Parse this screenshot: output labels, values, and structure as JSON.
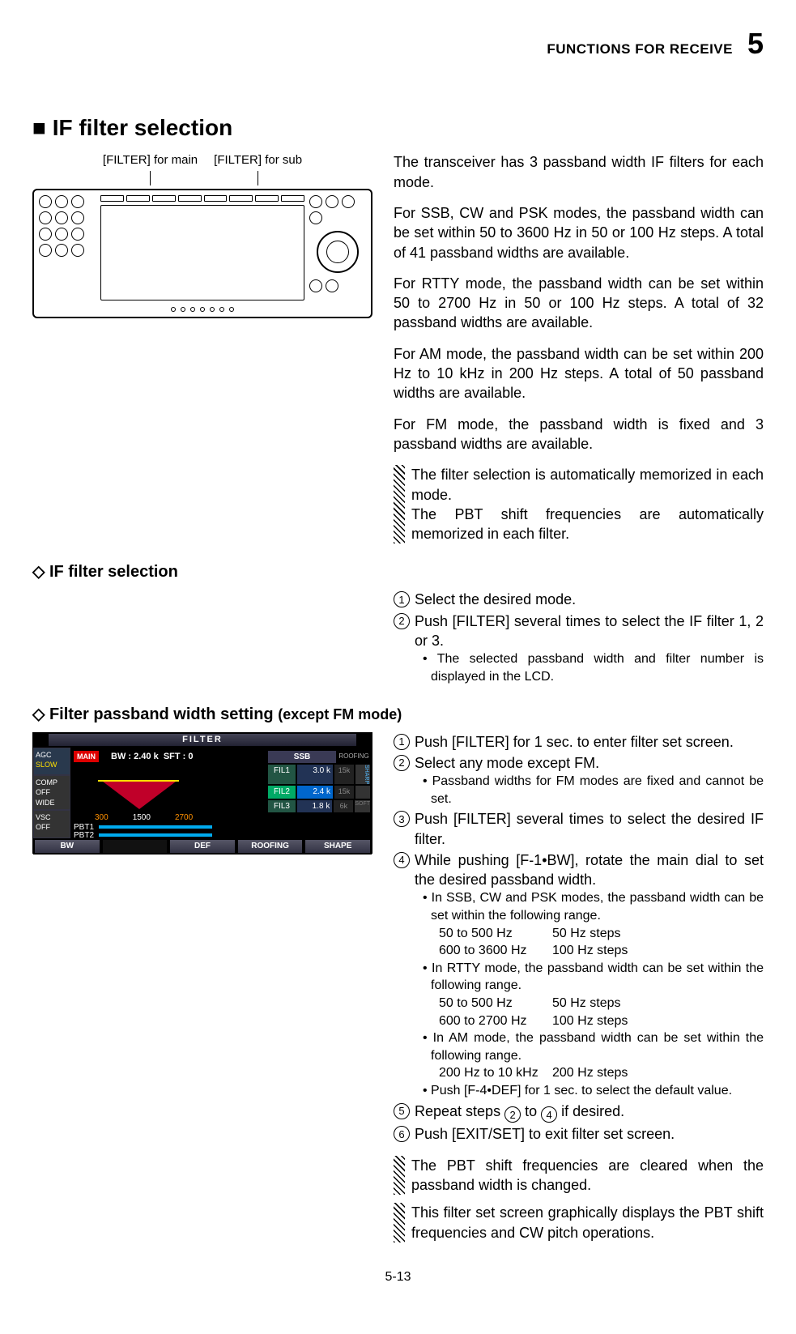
{
  "header": {
    "section": "FUNCTIONS FOR RECEIVE",
    "chapter": "5"
  },
  "h1": "■ IF filter selection",
  "callouts": {
    "main": "[FILTER] for main",
    "sub": "[FILTER] for sub"
  },
  "intro": {
    "p1": "The transceiver has 3 passband width IF filters for each mode.",
    "p2": "For SSB, CW and PSK modes, the passband width can be set within 50 to 3600 Hz in 50 or 100 Hz steps. A total of 41 passband widths are available.",
    "p3": "For RTTY mode, the passband width can be set within 50 to 2700 Hz in 50 or 100 Hz steps. A total of 32 passband widths are available.",
    "p4": "For AM mode, the passband width can be set within 200 Hz to 10 kHz in 200 Hz steps. A total of 50 passband widths are available.",
    "p5": "For FM mode, the passband width is fixed and 3 passband widths are available.",
    "note1": "The filter selection is automatically memorized in each mode.",
    "note2": "The PBT shift frequencies are automatically memorized in each filter."
  },
  "sec2": {
    "title": "◇ IF filter selection",
    "s1": "Select the desired mode.",
    "s2": "Push [FILTER] several times to select the IF filter 1, 2 or 3.",
    "s2b": "• The selected passband width and filter number is displayed in the LCD."
  },
  "sec3": {
    "title": "◇ Filter passband width setting",
    "title_paren": "(except FM mode)",
    "s1": "Push [FILTER] for 1 sec. to enter filter set screen.",
    "s2": "Select any mode except FM.",
    "s2b": "• Passband widths for FM modes are fixed and cannot be set.",
    "s3": "Push [FILTER] several times to select the desired IF filter.",
    "s4": "While pushing [F-1•BW], rotate the main dial to set the desired passband width.",
    "s4a": "• In SSB, CW and PSK modes, the passband width can be set within the following range.",
    "r1a": "50 to 500 Hz",
    "r1b": "50 Hz steps",
    "r2a": "600 to 3600 Hz",
    "r2b": "100 Hz steps",
    "s4b": "• In RTTY mode, the passband width can be set within the following range.",
    "r3a": "50 to 500 Hz",
    "r3b": "50 Hz steps",
    "r4a": "600 to 2700 Hz",
    "r4b": "100 Hz steps",
    "s4c": "• In AM mode, the passband width can be set within the following range.",
    "r5a": "200 Hz to 10 kHz",
    "r5b": "200 Hz steps",
    "s4d": "• Push [F-4•DEF] for 1 sec. to select the default value.",
    "s5a": "Repeat steps ",
    "s5b": " to ",
    "s5c": " if desired.",
    "s6": "Push [EXIT/SET] to exit filter set screen.",
    "note1": "The PBT shift frequencies are cleared when the passband width is changed.",
    "note2": "This filter set screen graphically displays the PBT shift frequencies and CW pitch operations."
  },
  "filter_screen": {
    "title": "FILTER",
    "agc": "AGC",
    "slow": "SLOW",
    "comp1": "COMP",
    "comp2": "OFF",
    "comp3": "WIDE",
    "vsc1": "VSC",
    "vsc2": "OFF",
    "main": "MAIN",
    "bw": "BW : 2.40 k",
    "sft": "SFT :    0",
    "ssb": "SSB",
    "roofing": "ROOFING",
    "fil1a": "FIL1",
    "fil1b": "3.0 k",
    "fil1c": "15k",
    "fil2a": "FIL2",
    "fil2b": "2.4 k",
    "fil2c": "15k",
    "fil3a": "FIL3",
    "fil3b": "1.8 k",
    "fil3c": "6k",
    "sharp": "SHARP",
    "soft": "SOFT",
    "f300": "300",
    "f1500": "1500",
    "f2700": "2700",
    "pbt1": "PBT1",
    "pbt2": "PBT2",
    "btn_bw": "BW",
    "btn_def": "DEF",
    "btn_roof": "ROOFING",
    "btn_shape": "SHAPE"
  },
  "page": "5-13"
}
